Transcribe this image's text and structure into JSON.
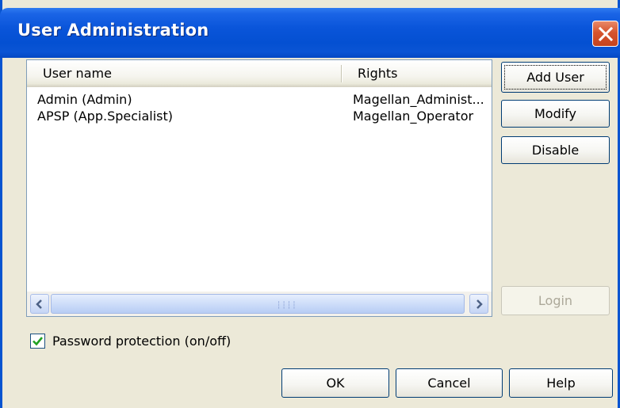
{
  "window": {
    "title": "User Administration",
    "close_icon": "close-icon"
  },
  "user_list": {
    "columns": [
      "User name",
      "Rights"
    ],
    "rows": [
      {
        "name": "Admin (Admin)",
        "rights": "Magellan_Administ..."
      },
      {
        "name": "APSP (App.Specialist)",
        "rights": "Magellan_Operator"
      }
    ]
  },
  "side_buttons": {
    "add_user": "Add User",
    "modify": "Modify",
    "disable": "Disable",
    "login": "Login"
  },
  "password_protection": {
    "label": "Password protection (on/off)",
    "checked": true
  },
  "footer_buttons": {
    "ok": "OK",
    "cancel": "Cancel",
    "help": "Help"
  },
  "colors": {
    "titlebar": "#0a55da",
    "close_button": "#d6542e",
    "dialog_background": "#ece9d8",
    "checkmark": "#21a121"
  }
}
